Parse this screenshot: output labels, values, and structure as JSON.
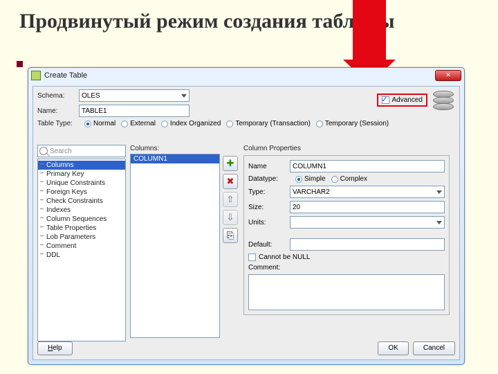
{
  "slide_title": "Продвинутый режим создания таблицы",
  "dialog_title": "Create Table",
  "close_glyph": "✕",
  "advanced_label": "Advanced",
  "schema": {
    "label": "Schema:",
    "value": "OLES"
  },
  "name": {
    "label": "Name:",
    "value": "TABLE1"
  },
  "table_type": {
    "label": "Table Type:",
    "options": [
      "Normal",
      "External",
      "Index Organized",
      "Temporary (Transaction)",
      "Temporary (Session)"
    ],
    "selected": "Normal"
  },
  "search_placeholder": "Search",
  "nav": [
    "Columns",
    "Primary Key",
    "Unique Constraints",
    "Foreign Keys",
    "Check Constraints",
    "Indexes",
    "Column Sequences",
    "Table Properties",
    "Lob Parameters",
    "Comment",
    "DDL"
  ],
  "nav_selected": 0,
  "columns_header": "Columns:",
  "columns": [
    "COLUMN1"
  ],
  "columns_selected": 0,
  "btn_icons": {
    "add": "✚",
    "del": "✖",
    "up": "⇧",
    "down": "⇩",
    "copy": "⎘"
  },
  "props": {
    "header": "Column Properties",
    "name_label": "Name",
    "name_value": "COLUMN1",
    "datatype_label": "Datatype:",
    "datatype_options": [
      "Simple",
      "Complex"
    ],
    "datatype_selected": "Simple",
    "type_label": "Type:",
    "type_value": "VARCHAR2",
    "size_label": "Size:",
    "size_value": "20",
    "units_label": "Units:",
    "units_value": "",
    "default_label": "Default:",
    "default_value": "",
    "notnull_label": "Cannot be NULL",
    "comment_label": "Comment:"
  },
  "footer": {
    "help": "Help",
    "ok": "OK",
    "cancel": "Cancel"
  }
}
